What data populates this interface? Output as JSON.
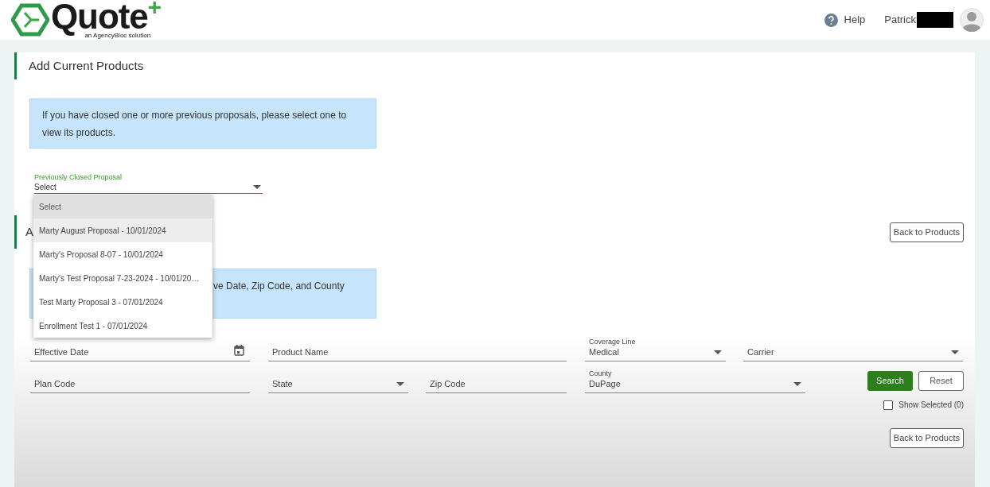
{
  "header": {
    "logo_text": "Quote",
    "logo_plus": "+",
    "logo_tagline": "an AgencyBloc solution",
    "help": "Help",
    "user_name": "Patrick",
    "user_name_redacted": true
  },
  "section_1": {
    "title": "Add Current Products",
    "info": "If you have closed one or more previous proposals, please select one to view its products.",
    "proposal_select": {
      "label": "Previously Closed Proposal",
      "value": "Select",
      "expanded": true,
      "options": [
        {
          "label": "Select",
          "selected": true,
          "hovered": false
        },
        {
          "label": "Marty August Proposal - 10/01/2024",
          "selected": false,
          "hovered": true
        },
        {
          "label": "Marty's Proposal 8-07 - 10/01/2024",
          "selected": false,
          "hovered": false
        },
        {
          "label": "Marty's Test Proposal 7-23-2024 - 10/01/20…",
          "selected": false,
          "hovered": false
        },
        {
          "label": "Test Marty Proposal 3 - 07/01/2024",
          "selected": false,
          "hovered": false
        },
        {
          "label": "Enrollment Test 1 - 07/01/2024",
          "selected": false,
          "hovered": false
        }
      ]
    }
  },
  "section_2": {
    "title": "A",
    "back_button": "Back to Products",
    "info": "ve Date, Zip Code, and County",
    "filter_rows": [
      [
        {
          "kind": "date",
          "label": "Effective Date"
        },
        {
          "kind": "text",
          "label": "Product Name"
        },
        {
          "kind": "select",
          "label": "Coverage Line",
          "value": "Medical"
        },
        {
          "kind": "select",
          "label": "Carrier"
        }
      ],
      [
        {
          "kind": "text",
          "label": "Plan Code"
        },
        {
          "kind": "select",
          "label": "State"
        },
        {
          "kind": "text",
          "label": "Zip Code"
        },
        {
          "kind": "select",
          "label": "County",
          "value": "DuPage"
        }
      ]
    ],
    "search_button": "Search",
    "reset_button": "Reset",
    "show_selected": {
      "label": "Show Selected (0)",
      "checked": false
    },
    "bottom_back_button": "Back to Products"
  }
}
